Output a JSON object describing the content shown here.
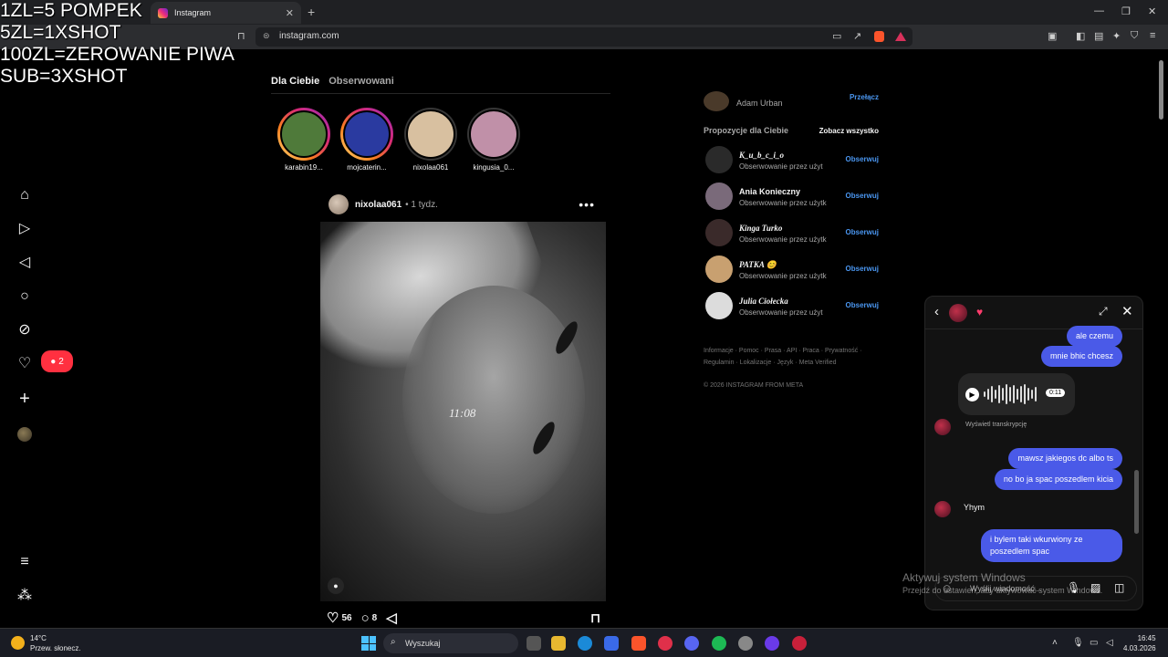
{
  "overlay": {
    "lines": [
      "1ZL=5 POMPEK",
      "5ZL=1XSHOT",
      "100ZL=ZEROWANIE PIWA",
      "SUB=3XSHOT"
    ]
  },
  "browser": {
    "tab_title": "Instagram",
    "url": "instagram.com"
  },
  "sidebar": {
    "notification_count": "2"
  },
  "feed": {
    "tabs": [
      "Dla Ciebie",
      "Obserwowani"
    ],
    "stories": [
      {
        "name": "karabin19...",
        "ring": "active",
        "color": "#4f7a3a"
      },
      {
        "name": "mojcaterin...",
        "ring": "active",
        "color": "#2a3aa0"
      },
      {
        "name": "nixolaa061",
        "ring": "seen",
        "color": "#d8c0a0"
      },
      {
        "name": "kingusia_0...",
        "ring": "seen",
        "color": "#c090a8"
      }
    ],
    "post": {
      "user": "nixolaa061",
      "time": "• 1 tydz.",
      "more": "•••",
      "image_stamp": "11:08",
      "likes": "56",
      "comments": "8"
    }
  },
  "right_panel": {
    "account_name": "Adam Urban",
    "switch_label": "Przełącz",
    "suggestions_title": "Propozycje dla Ciebie",
    "see_all": "Zobacz wszystko",
    "suggestions": [
      {
        "name": "K_u_b_c_i_o",
        "sub": "Obserwowanie przez użyt",
        "follow": "Obserwuj",
        "color": "#2a2a2a"
      },
      {
        "name": "Ania Konieczny",
        "sub": "Obserwowanie przez użytk",
        "follow": "Obserwuj",
        "color": "#7a6a7a"
      },
      {
        "name": "Kinga Turko",
        "sub": "Obserwowanie przez użytk",
        "follow": "Obserwuj",
        "color": "#3a2a2a"
      },
      {
        "name": "PATKA 😊",
        "sub": "Obserwowanie przez użytk",
        "follow": "Obserwuj",
        "color": "#c8a070"
      },
      {
        "name": "Julia Ciołecka",
        "sub": "Obserwowanie przez użyt",
        "follow": "Obserwuj",
        "color": "#dcdcdc"
      }
    ],
    "footer_line1": "Informacje · Pomoc · Prasa · API · Praca · Prywatność ·",
    "footer_line2": "Regulamin · Lokalizacje · Język · Meta Verified",
    "copyright": "© 2026 INSTAGRAM FROM META"
  },
  "chat": {
    "heart": "♥",
    "messages": {
      "m1": "ale czemu",
      "m2": "mnie bhic chcesz",
      "voice_duration": "0:11",
      "transcription": "Wyświetl transkrypcję",
      "m3": "mawsz jakiegos dc albo ts",
      "m4": "no bo ja spac poszedlem kicia",
      "m5": "Yhym",
      "m6": "i bylem taki wkurwiony ze poszedlem spac"
    },
    "input_placeholder": "Wyślij wiadomość..."
  },
  "windows": {
    "activate_title": "Aktywuj system Windows",
    "activate_sub": "Przejdź do ustawień, aby aktywować system Windows.",
    "weather_temp": "14°C",
    "weather_desc": "Przew. słonecz.",
    "search_label": "Wyszukaj",
    "time": "16:45",
    "date": "4.03.2026"
  }
}
